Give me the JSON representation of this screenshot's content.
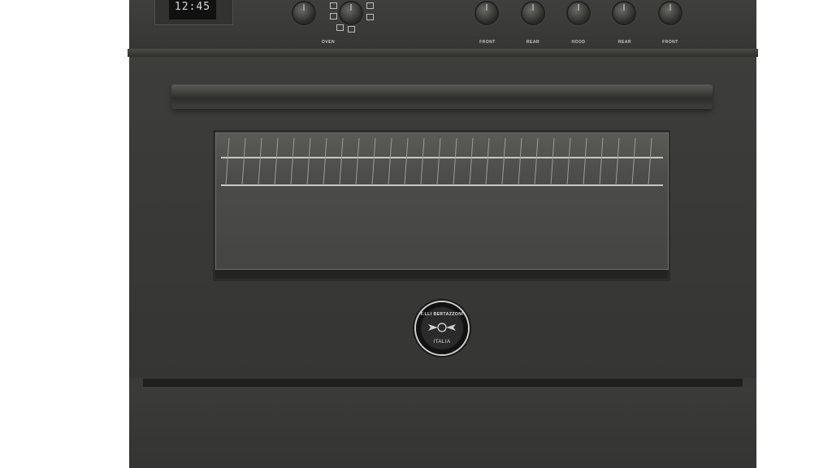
{
  "clock": {
    "time": "12:45"
  },
  "controls": {
    "oven_label": "OVEN",
    "burner_labels": [
      "FRONT",
      "REAR",
      "HOOD",
      "REAR",
      "FRONT"
    ]
  },
  "badge": {
    "brand": "F.LLI BERTAZZONI",
    "origin": "ITALIA"
  },
  "colors": {
    "body": "#3a3a38",
    "background": "#ffffff",
    "display": "#111111"
  }
}
